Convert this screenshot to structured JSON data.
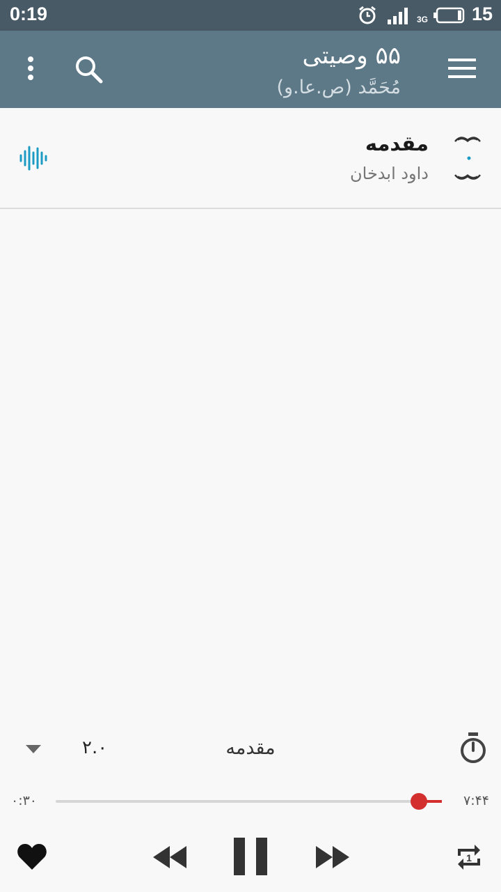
{
  "status_bar": {
    "time": "0:19",
    "network": "3G",
    "battery": "15"
  },
  "app_bar": {
    "title": "۵۵ وصیتی",
    "subtitle": "مُحَمَّد (ص.عا.و)",
    "icons": [
      "menu-icon",
      "search-icon",
      "more-vert-icon"
    ]
  },
  "track": {
    "title": "مقدمه",
    "artist": "داود ابدخان",
    "icons": [
      "ornament-icon",
      "audio-wave-icon"
    ],
    "accent_color": "#1b9bc4"
  },
  "player": {
    "title": "مقدمه",
    "speed": "۲.۰",
    "elapsed": "۰:۳۰",
    "duration": "۷:۴۴",
    "progress": 0.94,
    "accent_color": "#d32f2f",
    "icons": [
      "timer-icon",
      "dropdown-arrow-icon",
      "heart-icon",
      "rewind-icon",
      "pause-icon",
      "fast-forward-icon",
      "repeat-one-icon"
    ]
  }
}
